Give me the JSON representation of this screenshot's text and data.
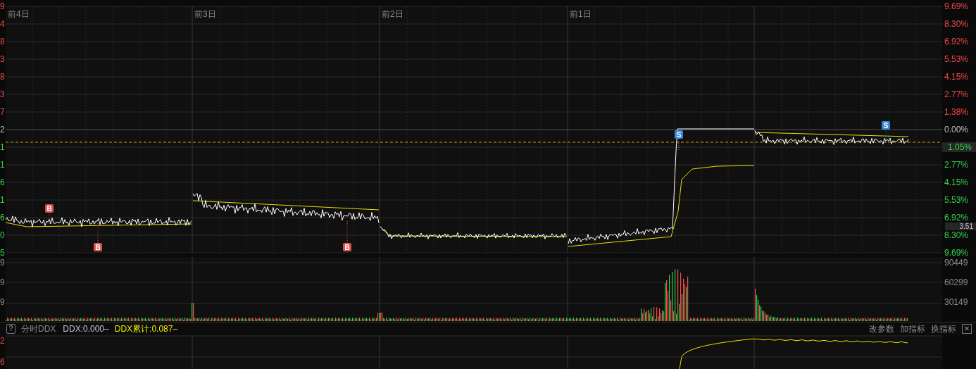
{
  "left_axis": {
    "price": [
      {
        "text": "9",
        "kind": "up"
      },
      {
        "text": "4",
        "kind": "up"
      },
      {
        "text": "8",
        "kind": "up"
      },
      {
        "text": "3",
        "kind": "up"
      },
      {
        "text": "8",
        "kind": "up"
      },
      {
        "text": "3",
        "kind": "up"
      },
      {
        "text": "7",
        "kind": "up"
      },
      {
        "text": "2",
        "kind": "flat"
      },
      {
        "text": "1",
        "kind": "down"
      },
      {
        "text": "1",
        "kind": "down"
      },
      {
        "text": "6",
        "kind": "down"
      },
      {
        "text": "1",
        "kind": "down"
      },
      {
        "text": "6",
        "kind": "down"
      },
      {
        "text": "0",
        "kind": "down"
      },
      {
        "text": "5",
        "kind": "down"
      }
    ],
    "volume": [
      "9",
      "9",
      "9"
    ],
    "ddx": [
      "2",
      "6"
    ]
  },
  "days": [
    "前4日",
    "前3日",
    "前2日",
    "前1日"
  ],
  "markers": [
    {
      "kind": "buy",
      "text": "B"
    },
    {
      "kind": "buy",
      "text": "B"
    },
    {
      "kind": "buy",
      "text": "B"
    },
    {
      "kind": "sell",
      "text": "S"
    },
    {
      "kind": "sell",
      "text": "S"
    }
  ],
  "right_axis": {
    "price": [
      {
        "text": "9.69%",
        "kind": "up"
      },
      {
        "text": "8.30%",
        "kind": "up"
      },
      {
        "text": "6.92%",
        "kind": "up"
      },
      {
        "text": "5.53%",
        "kind": "up"
      },
      {
        "text": "4.15%",
        "kind": "up"
      },
      {
        "text": "2.77%",
        "kind": "up"
      },
      {
        "text": "1.38%",
        "kind": "up"
      },
      {
        "text": "0.00%",
        "kind": "flat"
      },
      {
        "text": "1.05%",
        "kind": "tag"
      },
      {
        "text": "2.77%",
        "kind": "down"
      },
      {
        "text": "4.15%",
        "kind": "down"
      },
      {
        "text": "5.53%",
        "kind": "down"
      },
      {
        "text": "6.92%",
        "kind": "down"
      },
      {
        "text": "8.30%",
        "kind": "down"
      },
      {
        "text": "9.69%",
        "kind": "down"
      }
    ],
    "cursor_price": "3.51",
    "volume": [
      "90449",
      "60299",
      "30149"
    ]
  },
  "ddx_bar": {
    "help": "?",
    "name": "分时DDX",
    "ddx": "DDX:0.000–",
    "ddx_total": "DDX累计:0.087–",
    "actions": [
      "改参数",
      "加指标",
      "换指标"
    ],
    "close": "✕"
  }
}
